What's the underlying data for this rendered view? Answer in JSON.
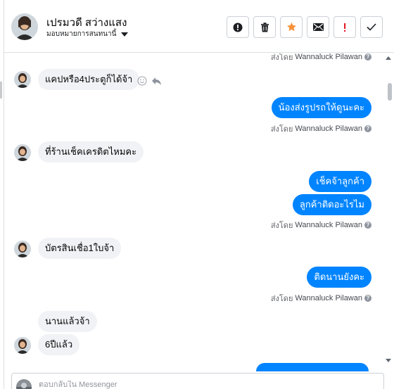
{
  "header": {
    "contact_name": "เปรมวดี สว่างแสง",
    "assign_label": "มอบหมายการสนทนานี้",
    "actions": [
      {
        "name": "spam-button",
        "icon": "exclamation-circle-icon"
      },
      {
        "name": "delete-button",
        "icon": "trash-icon"
      },
      {
        "name": "follow-up-button",
        "icon": "star-icon"
      },
      {
        "name": "mark-unread-button",
        "icon": "envelope-icon"
      },
      {
        "name": "priority-button",
        "icon": "exclamation-icon"
      },
      {
        "name": "mark-done-button",
        "icon": "check-icon"
      }
    ]
  },
  "thread": {
    "sent_by_prefix": "ส่งโดย",
    "sender": "Wannaluck Pilawan",
    "messages": [
      {
        "dir": "in",
        "text": "แคปหรือ4ประตูก็ได้จ้า"
      },
      {
        "dir": "out",
        "text": "น้องส่งรูปรถให้ดูนะคะ"
      },
      {
        "dir": "in",
        "text": "ที่ร้านเช็คเครดิตไหมคะ"
      },
      {
        "dir": "out",
        "text": "เช็คจ้าลูกค้า"
      },
      {
        "dir": "out",
        "text": "ลูกค้าติดอะไรไม"
      },
      {
        "dir": "in",
        "text": "บัตรสินเชื่อ1ใบจ้า"
      },
      {
        "dir": "out",
        "text": "ติดนานยังคะ"
      },
      {
        "dir": "in",
        "text": "นานแล้วจ้า"
      },
      {
        "dir": "in",
        "text": "6ปีแล้ว"
      }
    ]
  },
  "composer": {
    "placeholder": "ตอบกลับใน Messenger"
  },
  "colors": {
    "outgoing_bubble": "#0084ff",
    "incoming_bubble": "#f0f2f5",
    "star": "#f7923a",
    "priority": "#e4202a"
  }
}
